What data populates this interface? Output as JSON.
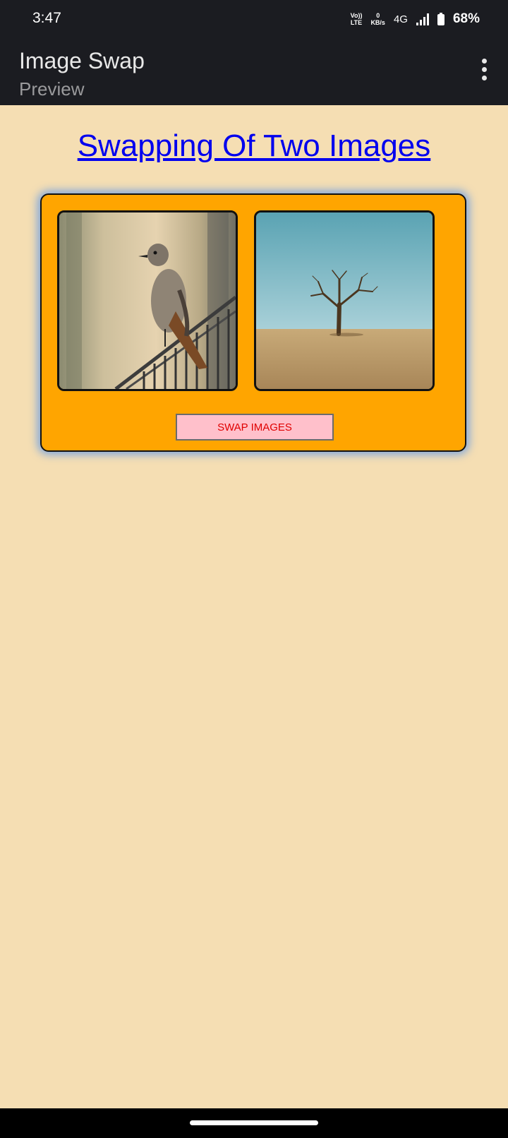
{
  "status_bar": {
    "time": "3:47",
    "volte_top": "Vo))",
    "volte_bottom": "LTE",
    "speed_value": "0",
    "speed_unit": "KB/s",
    "network": "4G",
    "battery": "68%",
    "icons": [
      "volte-icon",
      "signal-icon",
      "battery-icon"
    ]
  },
  "app_bar": {
    "title": "Image Swap",
    "subtitle": "Preview",
    "menu_icon": "more-vertical-icon"
  },
  "main": {
    "heading": "Swapping Of Two Images",
    "swap_button": "SWAP IMAGES",
    "images": [
      {
        "subject": "bird on railing"
      },
      {
        "subject": "bare tree in desert"
      }
    ]
  },
  "colors": {
    "background": "#f5deb3",
    "card": "#ffa500",
    "button_bg": "#ffc0cb",
    "button_text": "#e00000",
    "link": "#0000ee",
    "bars": "#1b1c21"
  }
}
